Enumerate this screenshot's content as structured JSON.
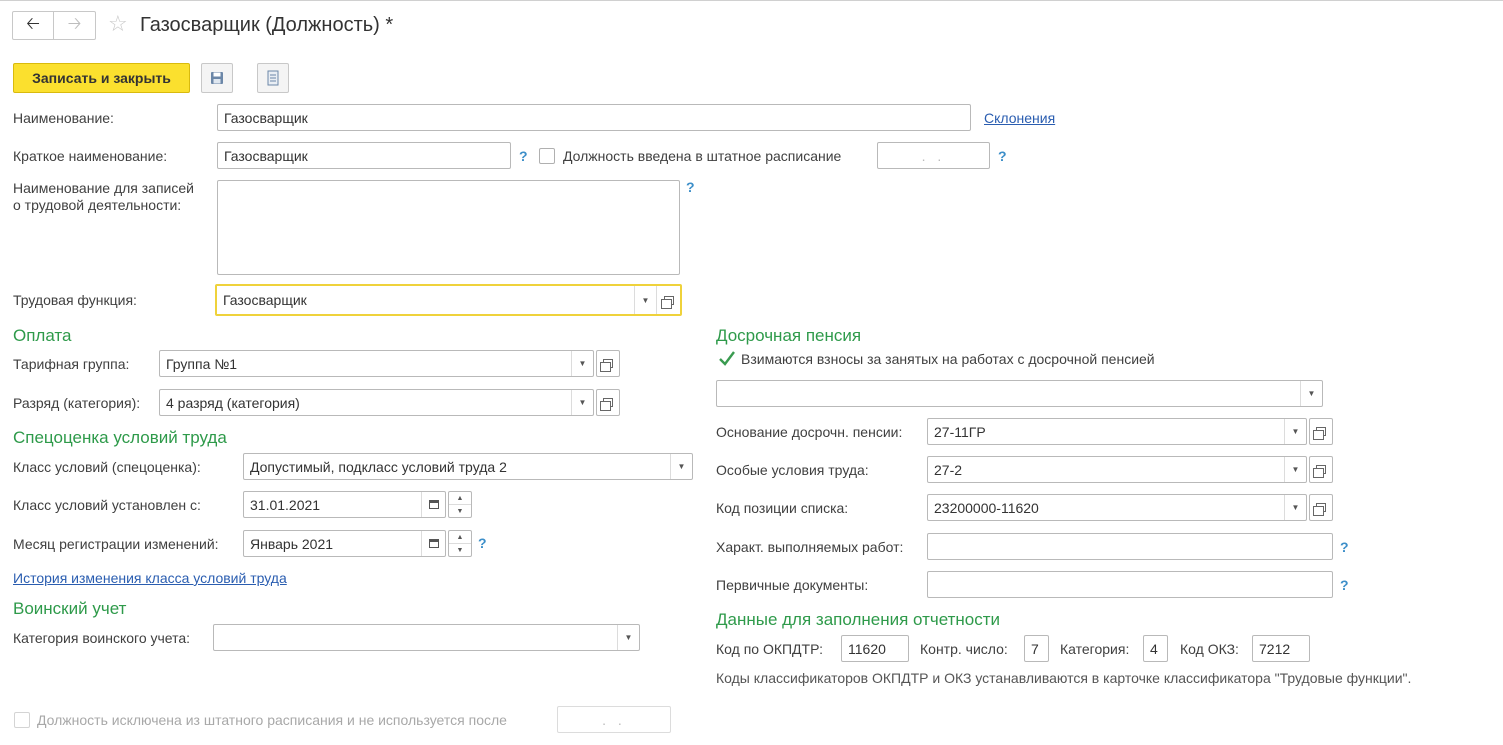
{
  "nav": {
    "back_icon": "arrow-left-icon",
    "forward_icon": "arrow-right-icon",
    "favorite_icon": "star-icon"
  },
  "window_title": "Газосварщик (Должность) *",
  "toolbar": {
    "save_close_label": "Записать и закрыть",
    "save_icon": "floppy-disk-icon",
    "more_icon": "document-list-icon"
  },
  "form": {
    "name_label": "Наименование:",
    "name_value": "Газосварщик",
    "declensions_link": "Склонения",
    "short_name_label": "Краткое наименование:",
    "short_name_value": "Газосварщик",
    "help_mark": "?",
    "staff_checkbox_label": "Должность введена в штатное расписание",
    "staff_checked": false,
    "staff_date_placeholder": ". .",
    "work_record_label_1": "Наименование для записей",
    "work_record_label_2": "о трудовой деятельности:",
    "work_record_value": "",
    "labor_function_label": "Трудовая функция:",
    "labor_function_value": "Газосварщик"
  },
  "payment": {
    "title": "Оплата",
    "tariff_group_label": "Тарифная группа:",
    "tariff_group_value": "Группа №1",
    "grade_label": "Разряд (категория):",
    "grade_value": "4 разряд (категория)"
  },
  "special_assessment": {
    "title": "Спецоценка условий труда",
    "class_label": "Класс условий (спецоценка):",
    "class_value": "Допустимый, подкласс условий труда 2",
    "class_since_label": "Класс условий установлен с:",
    "class_since_value": "31.01.2021",
    "reg_month_label": "Месяц регистрации изменений:",
    "reg_month_value": "Январь 2021",
    "history_link": "История изменения класса условий труда"
  },
  "military": {
    "title": "Воинский учет",
    "category_label": "Категория воинского учета:",
    "category_value": ""
  },
  "excluded": {
    "label": "Должность исключена из штатного расписания и не используется после",
    "checked": false,
    "date_placeholder": ". ."
  },
  "early_pension": {
    "title": "Досрочная пенсия",
    "contrib_label": "Взимаются взносы за занятых на работах с досрочной пенсией",
    "contrib_checked": true,
    "contrib_type_value": "",
    "basis_label": "Основание досрочн. пенсии:",
    "basis_value": "27-11ГР",
    "conditions_label": "Особые условия труда:",
    "conditions_value": "27-2",
    "list_code_label": "Код позиции списка:",
    "list_code_value": "23200000-11620",
    "work_char_label": "Характ. выполняемых работ:",
    "work_char_value": "",
    "primary_docs_label": "Первичные документы:",
    "primary_docs_value": ""
  },
  "reporting": {
    "title": "Данные для заполнения отчетности",
    "okpdtr_label": "Код по ОКПДТР:",
    "okpdtr_value": "11620",
    "check_label": "Контр. число:",
    "check_value": "7",
    "category_label": "Категория:",
    "category_value": "4",
    "okz_label": "Код ОКЗ:",
    "okz_value": "7212",
    "note": "Коды классификаторов ОКПДТР и ОКЗ устанавливаются в карточке классификатора \"Трудовые функции\"."
  },
  "colors": {
    "accent_button": "#fbe02e",
    "section_title": "#2e9a4a",
    "link": "#2a5db0",
    "help": "#3d8fc9",
    "focus_border": "#efd23b"
  }
}
